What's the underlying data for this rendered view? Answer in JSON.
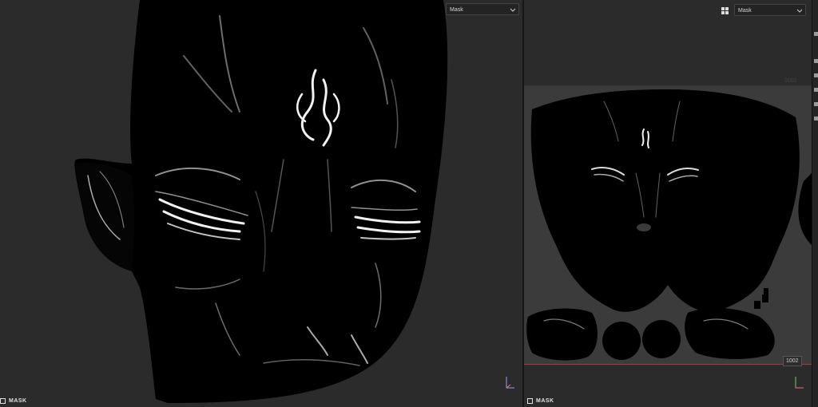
{
  "viewport_3d": {
    "channel_dropdown": {
      "selected": "Mask"
    },
    "mode_label": "MASK"
  },
  "viewport_2d": {
    "channel_dropdown": {
      "selected": "Mask"
    },
    "mode_label": "MASK",
    "coordinate_badge": "1002",
    "faint_label": "1002"
  },
  "colors": {
    "background": "#2b2b2b",
    "mask_white": "#f2f2f2",
    "mesh_black": "#000000",
    "boundary_red": "#b03a3a"
  }
}
